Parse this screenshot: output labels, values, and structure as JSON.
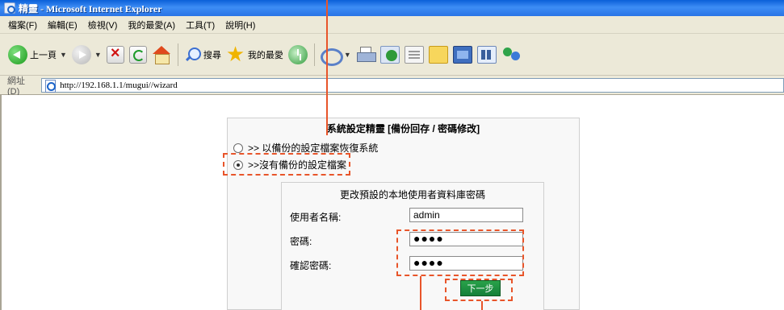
{
  "window": {
    "title": "精靈 - Microsoft Internet Explorer"
  },
  "menubar": {
    "items": [
      "檔案(F)",
      "編輯(E)",
      "檢視(V)",
      "我的最愛(A)",
      "工具(T)",
      "說明(H)"
    ]
  },
  "toolbar": {
    "back_label": "上一頁",
    "search_label": "搜尋",
    "favorites_label": "我的最愛"
  },
  "address": {
    "label": "網址(D)",
    "url": "http://192.168.1.1/mugui//wizard"
  },
  "wizard": {
    "title": "系統設定精靈 [備份回存 / 密碼修改]",
    "option_restore": ">> 以備份的設定檔案恢復系統",
    "option_no_backup": ">>沒有備份的設定檔案",
    "selected_option": "no_backup",
    "form": {
      "title": "更改預設的本地使用者資料庫密碼",
      "username_label": "使用者名稱:",
      "username_value": "admin",
      "password_label": "密碼:",
      "password_value": "●●●●",
      "confirm_label": "確認密碼:",
      "confirm_value": "●●●●",
      "next_button": "下一步"
    }
  },
  "colors": {
    "titlebar": "#2a74e6",
    "chrome": "#ece9d8",
    "annotation": "#e8552a",
    "next_button": "#1a8f40"
  }
}
